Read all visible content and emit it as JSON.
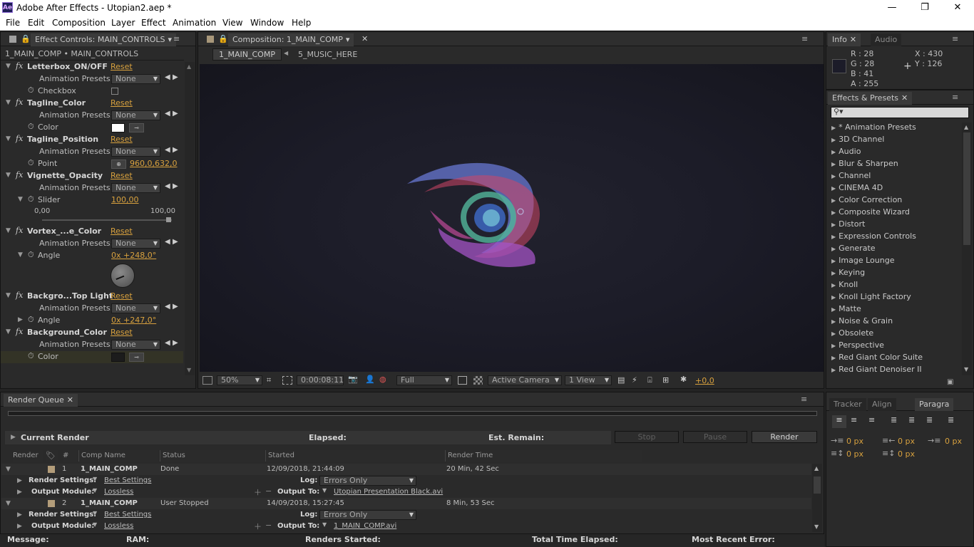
{
  "window": {
    "app_icon": "Ae",
    "title": "Adobe After Effects - Utopian2.aep *",
    "min": "—",
    "max": "❐",
    "close": "✕"
  },
  "menu": [
    "File",
    "Edit",
    "Composition",
    "Layer",
    "Effect",
    "Animation",
    "View",
    "Window",
    "Help"
  ],
  "effect_controls": {
    "tab": "Effect Controls: MAIN_CONTROLS",
    "breadcrumb": "1_MAIN_COMP • MAIN_CONTROLS",
    "reset": "Reset",
    "presets_label": "Animation Presets:",
    "presets_value": "None",
    "effects": [
      {
        "name": "Letterbox_ON/OFF",
        "prop": "Checkbox"
      },
      {
        "name": "Tagline_Color",
        "prop": "Color"
      },
      {
        "name": "Tagline_Position",
        "prop": "Point",
        "value": "960,0,632,0"
      },
      {
        "name": "Vignette_Opacity",
        "prop": "Slider",
        "value": "100,00",
        "min": "0,00",
        "max": "100,00"
      },
      {
        "name": "Vortex_...e_Color",
        "prop": "Angle",
        "value": "0x +248,0°"
      },
      {
        "name": "Backgro...Top Light",
        "prop": "Angle",
        "value": "0x +247,0°"
      },
      {
        "name": "Background_Color",
        "prop": "Color"
      }
    ]
  },
  "composition": {
    "tab": "Composition: 1_MAIN_COMP",
    "flow_tabs": [
      "1_MAIN_COMP",
      "5_MUSIC_HERE"
    ],
    "zoom": "50%",
    "timecode": "0:00:08:11",
    "resolution": "Full",
    "camera": "Active Camera",
    "view": "1 View",
    "exposure": "+0,0"
  },
  "info": {
    "tab": "Info",
    "tab2": "Audio",
    "r": "R : 28",
    "g": "G : 28",
    "b": "B : 41",
    "a": "A : 255",
    "x": "X : 430",
    "y": "Y : 126"
  },
  "effects_presets": {
    "tab": "Effects & Presets",
    "search_placeholder": "",
    "items": [
      "* Animation Presets",
      "3D Channel",
      "Audio",
      "Blur & Sharpen",
      "Channel",
      "CINEMA 4D",
      "Color Correction",
      "Composite Wizard",
      "Distort",
      "Expression Controls",
      "Generate",
      "Image Lounge",
      "Keying",
      "Knoll",
      "Knoll Light Factory",
      "Matte",
      "Noise & Grain",
      "Obsolete",
      "Perspective",
      "Red Giant Color Suite",
      "Red Giant Denoiser II"
    ]
  },
  "paragraph": {
    "tabs": [
      "Tracker",
      "Align",
      "Paragra"
    ],
    "px_values": [
      "0 px",
      "0 px",
      "0 px",
      "0 px",
      "0 px"
    ]
  },
  "render_queue": {
    "tab": "Render Queue",
    "current_render": "Current Render",
    "elapsed": "Elapsed:",
    "est_remain": "Est. Remain:",
    "stop": "Stop",
    "pause": "Pause",
    "render": "Render",
    "columns": [
      "Render",
      "#",
      "Comp Name",
      "Status",
      "Started",
      "Render Time"
    ],
    "items": [
      {
        "num": "1",
        "comp": "1_MAIN_COMP",
        "status": "Done",
        "started": "12/09/2018, 21:44:09",
        "time": "20 Min, 42 Sec",
        "settings": "Best Settings",
        "log": "Errors Only",
        "module": "Lossless",
        "output": "Utopian Presentation Black.avi"
      },
      {
        "num": "2",
        "comp": "1_MAIN_COMP",
        "status": "User Stopped",
        "started": "14/09/2018, 15:27:45",
        "time": "8 Min, 53 Sec",
        "settings": "Best Settings",
        "log": "Errors Only",
        "module": "Lossless",
        "output": "1_MAIN_COMP.avi"
      }
    ],
    "render_settings_label": "Render Settings:",
    "output_module_label": "Output Module:",
    "log_label": "Log:",
    "output_to_label": "Output To:"
  },
  "status_bar": {
    "message": "Message:",
    "ram": "RAM:",
    "renders_started": "Renders Started:",
    "total_time": "Total Time Elapsed:",
    "recent_error": "Most Recent Error:"
  }
}
